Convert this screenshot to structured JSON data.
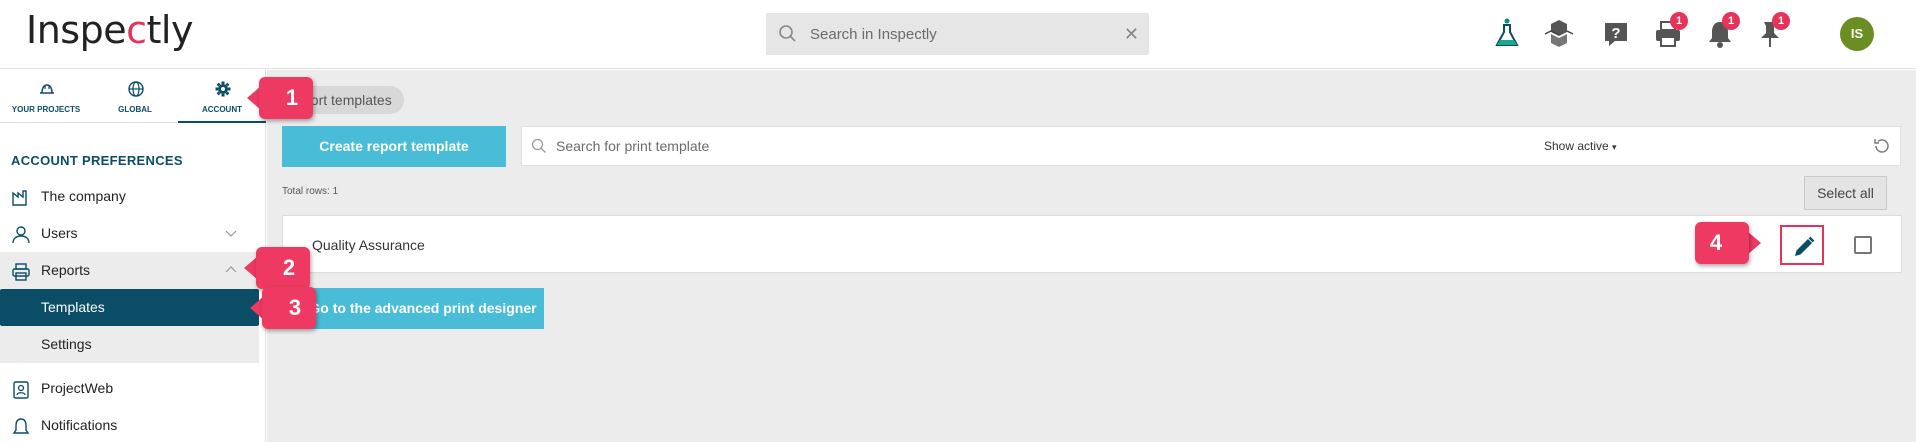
{
  "app": {
    "logo_text_a": "Inspe",
    "logo_text_mark": "c",
    "logo_text_b": "tly",
    "search_placeholder": "Search in Inspectly",
    "clear_glyph": "✕",
    "avatar_initials": "IS",
    "toolbar": [
      {
        "name": "flask-icon",
        "badge": null
      },
      {
        "name": "cubes-icon",
        "badge": null
      },
      {
        "name": "help-icon",
        "badge": null
      },
      {
        "name": "printer-icon",
        "badge": "1"
      },
      {
        "name": "bell-icon",
        "badge": "1"
      },
      {
        "name": "pin-icon",
        "badge": "1"
      }
    ],
    "colors": {
      "accent": "#0b4d66",
      "brand": "#e5335a",
      "button": "#49bcd8",
      "avatar": "#6b8e23"
    }
  },
  "sidebar": {
    "tabs": [
      {
        "label": "YOUR PROJECTS",
        "icon": "helmet-icon"
      },
      {
        "label": "GLOBAL",
        "icon": "globe-icon"
      },
      {
        "label": "ACCOUNT",
        "icon": "gear-icon",
        "active": true
      }
    ],
    "section_title": "ACCOUNT PREFERENCES",
    "items": [
      {
        "label": "The company",
        "icon": "factory-icon"
      },
      {
        "label": "Users",
        "icon": "user-icon",
        "chevron": "down"
      },
      {
        "label": "Reports",
        "icon": "printer-icon",
        "chevron": "up"
      },
      {
        "label": "ProjectWeb",
        "icon": "contact-card-icon"
      },
      {
        "label": "Notifications",
        "icon": "bell-icon"
      }
    ],
    "submenu": [
      {
        "label": "Templates",
        "active": true
      },
      {
        "label": "Settings"
      }
    ]
  },
  "main": {
    "breadcrumb": "port templates",
    "create_button": "Create report template",
    "search_placeholder": "Search for print template",
    "filter_label": "Show active",
    "filter_caret": "▾",
    "total_rows": "Total rows: 1",
    "select_all": "Select all",
    "rows": [
      {
        "name": "Quality Assurance"
      }
    ],
    "advanced_button": "Go to the advanced print designer"
  },
  "callouts": [
    "1",
    "2",
    "3",
    "4"
  ]
}
